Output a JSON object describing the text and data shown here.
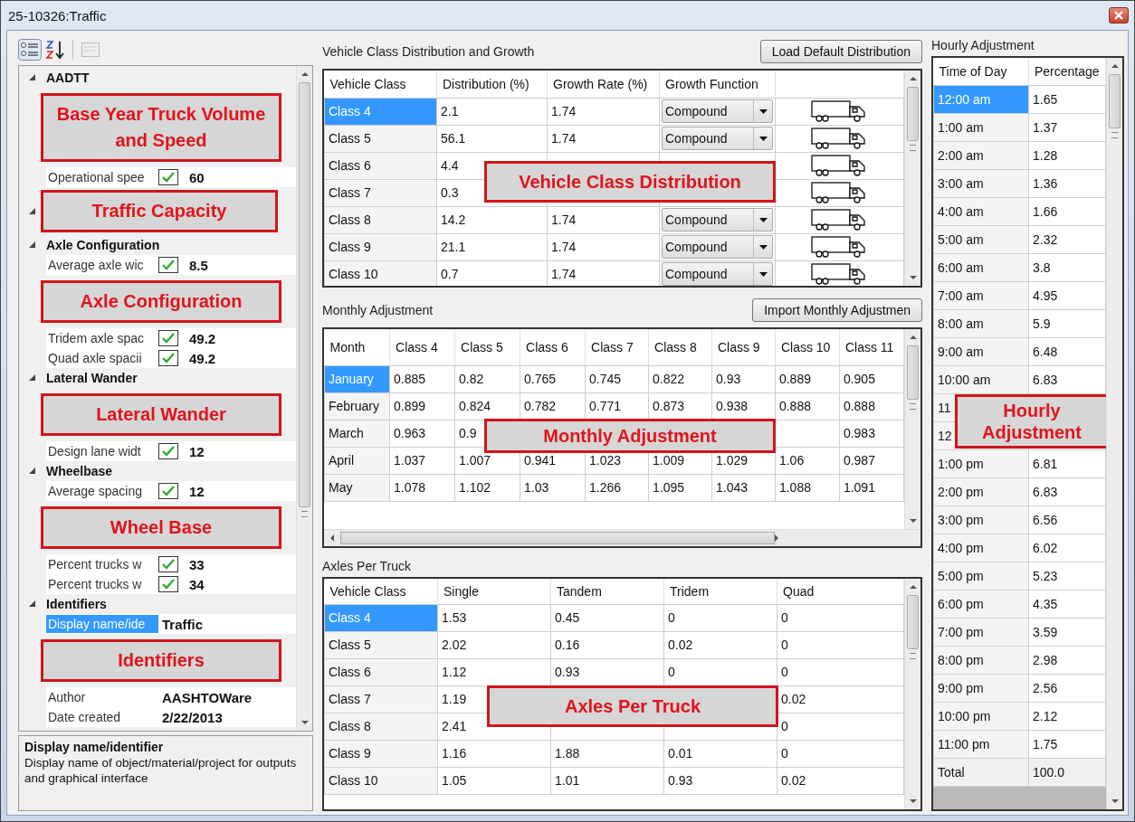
{
  "window": {
    "title": "25-10326:Traffic"
  },
  "property_grid": {
    "categories": [
      {
        "name": "AADTT",
        "expanded": true,
        "children": [
          {
            "kind": "callout",
            "text": "Base Year Truck Volume and Speed"
          },
          {
            "kind": "checkbox-property",
            "label": "Operational spee",
            "checked": true,
            "value": "60",
            "selected": false
          }
        ]
      },
      {
        "expanded": true,
        "callout": "Traffic Capacity"
      },
      {
        "name": "Axle Configuration",
        "expanded": true,
        "children": [
          {
            "kind": "checkbox-property",
            "label": "Average axle wic",
            "checked": true,
            "value": "8.5",
            "selected": false
          },
          {
            "kind": "callout",
            "text": "Axle Configuration"
          },
          {
            "kind": "checkbox-property",
            "label": "Tridem axle spac",
            "checked": true,
            "value": "49.2",
            "selected": false
          },
          {
            "kind": "checkbox-property",
            "label": "Quad axle spacii",
            "checked": true,
            "value": "49.2",
            "selected": false
          }
        ]
      },
      {
        "name": "Lateral Wander",
        "expanded": true,
        "children": [
          {
            "kind": "callout",
            "text": "Lateral Wander"
          },
          {
            "kind": "checkbox-property",
            "label": "Design lane widt",
            "checked": true,
            "value": "12",
            "selected": false
          }
        ]
      },
      {
        "name": "Wheelbase",
        "expanded": true,
        "children": [
          {
            "kind": "checkbox-property",
            "label": "Average spacing",
            "checked": true,
            "value": "12",
            "selected": false
          },
          {
            "kind": "callout",
            "text": "Wheel Base"
          },
          {
            "kind": "checkbox-property",
            "label": "Percent trucks w",
            "checked": true,
            "value": "33",
            "selected": false
          },
          {
            "kind": "checkbox-property",
            "label": "Percent trucks w",
            "checked": true,
            "value": "34",
            "selected": false
          }
        ]
      },
      {
        "name": "Identifiers",
        "expanded": true,
        "children": [
          {
            "kind": "property",
            "label": "Display name/ide",
            "value": "Traffic",
            "selected": true
          },
          {
            "kind": "callout",
            "text": "Identifiers"
          },
          {
            "kind": "property",
            "label": "Author",
            "value": "AASHTOWare",
            "selected": false
          },
          {
            "kind": "property",
            "label": "Date created",
            "value": "2/22/2013",
            "selected": false
          }
        ]
      }
    ],
    "help": {
      "title": "Display name/identifier",
      "text": "Display name of object/material/project for outputs and graphical interface"
    }
  },
  "vehicle_distribution": {
    "title": "Vehicle Class Distribution and Growth",
    "button": "Load Default Distribution",
    "callout": "Vehicle Class Distribution",
    "columns": [
      {
        "label": "Vehicle Class",
        "kind": "row-header"
      },
      {
        "label": "Distribution (%)",
        "kind": "text"
      },
      {
        "label": "Growth Rate (%)",
        "kind": "text"
      },
      {
        "label": "Growth Function",
        "kind": "dropdown"
      }
    ],
    "rows": [
      {
        "cells": [
          "Class 4",
          "2.1",
          "1.74",
          "Compound"
        ],
        "selected": true
      },
      {
        "cells": [
          "Class 5",
          "56.1",
          "1.74",
          "Compound"
        ],
        "selected": false
      },
      {
        "cells": [
          "Class 6",
          "4.4",
          null,
          null
        ],
        "selected": false
      },
      {
        "cells": [
          "Class 7",
          "0.3",
          null,
          null
        ],
        "selected": false
      },
      {
        "cells": [
          "Class 8",
          "14.2",
          "1.74",
          "Compound"
        ],
        "selected": false
      },
      {
        "cells": [
          "Class 9",
          "21.1",
          "1.74",
          "Compound"
        ],
        "selected": false
      },
      {
        "cells": [
          "Class 10",
          "0.7",
          "1.74",
          "Compound"
        ],
        "selected": false
      }
    ]
  },
  "monthly_adjustment": {
    "title": "Monthly Adjustment",
    "button": "Import Monthly Adjustmen",
    "callout": "Monthly Adjustment",
    "columns": [
      {
        "label": "Month",
        "kind": "row-header"
      },
      {
        "label": "Class 4",
        "kind": "text"
      },
      {
        "label": "Class 5",
        "kind": "text"
      },
      {
        "label": "Class 6",
        "kind": "text"
      },
      {
        "label": "Class 7",
        "kind": "text"
      },
      {
        "label": "Class 8",
        "kind": "text"
      },
      {
        "label": "Class 9",
        "kind": "text"
      },
      {
        "label": "Class 10",
        "kind": "text"
      },
      {
        "label": "Class 11",
        "kind": "text"
      }
    ],
    "rows": [
      {
        "cells": [
          "January",
          "0.885",
          "0.82",
          "0.765",
          "0.745",
          "0.822",
          "0.93",
          "0.889",
          "0.905"
        ],
        "selected": true
      },
      {
        "cells": [
          "February",
          "0.899",
          "0.824",
          "0.782",
          "0.771",
          "0.873",
          "0.938",
          "0.888",
          "0.888"
        ],
        "selected": false
      },
      {
        "cells": [
          "March",
          "0.963",
          "0.9",
          null,
          null,
          null,
          null,
          null,
          "0.983"
        ],
        "selected": false
      },
      {
        "cells": [
          "April",
          "1.037",
          "1.007",
          "0.941",
          "1.023",
          "1.009",
          "1.029",
          "1.06",
          "0.987"
        ],
        "selected": false
      },
      {
        "cells": [
          "May",
          "1.078",
          "1.102",
          "1.03",
          "1.266",
          "1.095",
          "1.043",
          "1.088",
          "1.091"
        ],
        "selected": false
      }
    ]
  },
  "axles_per_truck": {
    "title": "Axles Per Truck",
    "callout": "Axles Per Truck",
    "columns": [
      {
        "label": "Vehicle Class",
        "kind": "row-header"
      },
      {
        "label": "Single",
        "kind": "text"
      },
      {
        "label": "Tandem",
        "kind": "text"
      },
      {
        "label": "Tridem",
        "kind": "text"
      },
      {
        "label": "Quad",
        "kind": "text"
      }
    ],
    "rows": [
      {
        "cells": [
          "Class 4",
          "1.53",
          "0.45",
          "0",
          "0"
        ],
        "selected": true
      },
      {
        "cells": [
          "Class 5",
          "2.02",
          "0.16",
          "0.02",
          "0"
        ],
        "selected": false
      },
      {
        "cells": [
          "Class 6",
          "1.12",
          "0.93",
          "0",
          "0"
        ],
        "selected": false
      },
      {
        "cells": [
          "Class 7",
          "1.19",
          null,
          null,
          "0.02"
        ],
        "selected": false
      },
      {
        "cells": [
          "Class 8",
          "2.41",
          null,
          null,
          "0"
        ],
        "selected": false
      },
      {
        "cells": [
          "Class 9",
          "1.16",
          "1.88",
          "0.01",
          "0"
        ],
        "selected": false
      },
      {
        "cells": [
          "Class 10",
          "1.05",
          "1.01",
          "0.93",
          "0.02"
        ],
        "selected": false
      }
    ]
  },
  "hourly_adjustment": {
    "title": "Hourly Adjustment",
    "callout": "Hourly Adjustment",
    "columns": [
      {
        "label": "Time of Day",
        "kind": "row-header"
      },
      {
        "label": "Percentage",
        "kind": "text"
      }
    ],
    "rows": [
      {
        "cells": [
          "12:00 am",
          "1.65"
        ],
        "selected": true,
        "kind": "hour"
      },
      {
        "cells": [
          "1:00 am",
          "1.37"
        ],
        "selected": false,
        "kind": "hour"
      },
      {
        "cells": [
          "2:00 am",
          "1.28"
        ],
        "selected": false,
        "kind": "hour"
      },
      {
        "cells": [
          "3:00 am",
          "1.36"
        ],
        "selected": false,
        "kind": "hour"
      },
      {
        "cells": [
          "4:00 am",
          "1.66"
        ],
        "selected": false,
        "kind": "hour"
      },
      {
        "cells": [
          "5:00 am",
          "2.32"
        ],
        "selected": false,
        "kind": "hour"
      },
      {
        "cells": [
          "6:00 am",
          "3.8"
        ],
        "selected": false,
        "kind": "hour"
      },
      {
        "cells": [
          "7:00 am",
          "4.95"
        ],
        "selected": false,
        "kind": "hour"
      },
      {
        "cells": [
          "8:00 am",
          "5.9"
        ],
        "selected": false,
        "kind": "hour"
      },
      {
        "cells": [
          "9:00 am",
          "6.48"
        ],
        "selected": false,
        "kind": "hour"
      },
      {
        "cells": [
          "10:00 am",
          "6.83"
        ],
        "selected": false,
        "kind": "hour"
      },
      {
        "cells": [
          "11",
          null
        ],
        "selected": false,
        "kind": "hour"
      },
      {
        "cells": [
          "12",
          null
        ],
        "selected": false,
        "kind": "hour"
      },
      {
        "cells": [
          "1:00 pm",
          "6.81"
        ],
        "selected": false,
        "kind": "hour"
      },
      {
        "cells": [
          "2:00 pm",
          "6.83"
        ],
        "selected": false,
        "kind": "hour"
      },
      {
        "cells": [
          "3:00 pm",
          "6.56"
        ],
        "selected": false,
        "kind": "hour"
      },
      {
        "cells": [
          "4:00 pm",
          "6.02"
        ],
        "selected": false,
        "kind": "hour"
      },
      {
        "cells": [
          "5:00 pm",
          "5.23"
        ],
        "selected": false,
        "kind": "hour"
      },
      {
        "cells": [
          "6:00 pm",
          "4.35"
        ],
        "selected": false,
        "kind": "hour"
      },
      {
        "cells": [
          "7:00 pm",
          "3.59"
        ],
        "selected": false,
        "kind": "hour"
      },
      {
        "cells": [
          "8:00 pm",
          "2.98"
        ],
        "selected": false,
        "kind": "hour"
      },
      {
        "cells": [
          "9:00 pm",
          "2.56"
        ],
        "selected": false,
        "kind": "hour"
      },
      {
        "cells": [
          "10:00 pm",
          "2.12"
        ],
        "selected": false,
        "kind": "hour"
      },
      {
        "cells": [
          "11:00 pm",
          "1.75"
        ],
        "selected": false,
        "kind": "hour"
      },
      {
        "cells": [
          "Total",
          "100.0"
        ],
        "selected": false,
        "kind": "total"
      }
    ]
  }
}
